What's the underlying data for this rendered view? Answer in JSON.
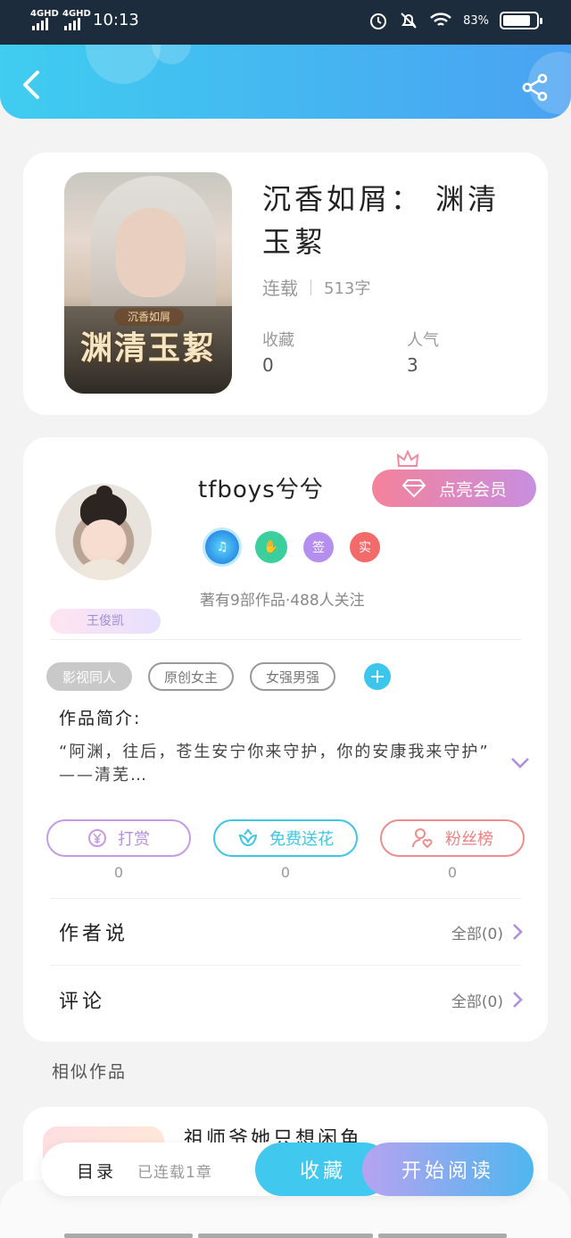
{
  "status_bar": {
    "network_1": "4GHD",
    "network_2": "4GHD",
    "time": "10:13",
    "battery": "83%",
    "battery_level": 0.83
  },
  "header": {
    "back_icon": "chevron-left-icon",
    "share_icon": "share-icon"
  },
  "book": {
    "cover_title": "渊清玉絜",
    "cover_subtitle": "沉香如屑",
    "title": "沉香如屑： 渊清玉絜",
    "status": "连载",
    "word_count": "513字",
    "favorites_label": "收藏",
    "favorites_value": "0",
    "popularity_label": "人气",
    "popularity_value": "3"
  },
  "author": {
    "name": "tfboys兮兮",
    "badge_name": "王俊凯",
    "vip_button": "点亮会员",
    "badges": [
      "music-badge-icon",
      "handshake-badge-icon",
      "签",
      "实"
    ],
    "stats": "著有9部作品·488人关注"
  },
  "tags": [
    "影视同人",
    "原创女主",
    "女强男强"
  ],
  "intro": {
    "label": "作品简介:",
    "text": "“阿渊，往后，苍生安宁你来守护，你的安康我来守护” ——清芜…"
  },
  "actions": {
    "reward_label": "打赏",
    "reward_count": "0",
    "flower_label": "免费送花",
    "flower_count": "0",
    "fans_label": "粉丝榜",
    "fans_count": "0"
  },
  "rows": {
    "author_says": "作者说",
    "author_says_all": "全部(0)",
    "comments": "评论",
    "comments_all": "全部(0)"
  },
  "similar": {
    "label": "相似作品",
    "first_title": "祖师爷她只想闲鱼"
  },
  "bottom_bar": {
    "toc": "目录",
    "serial_status": "已连载1章",
    "favorite_button": "收藏",
    "read_button": "开始阅读"
  },
  "colors": {
    "header_start": "#3fcdf0",
    "header_end": "#4aa2f2",
    "reward": "#c79be3",
    "flower": "#3ec7e4",
    "fans": "#ef8c8c",
    "accent_blue": "#41c8ef"
  }
}
